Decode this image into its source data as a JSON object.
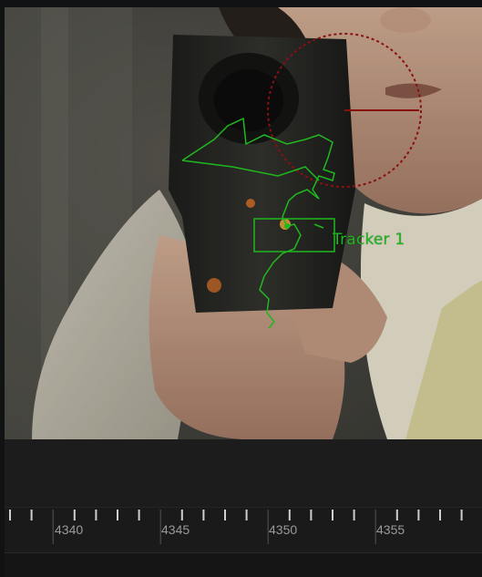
{
  "viewer": {
    "tracker": {
      "label": "Tracker 1",
      "color": "#1fb81f"
    },
    "offset_control": {
      "color": "#8a1010",
      "icon": "circle-crosshair-icon"
    }
  },
  "timeline": {
    "frame_labels": [
      "4340",
      "4345",
      "4350",
      "4355"
    ],
    "tick_color": "#cfcfcf",
    "label_color": "#9a9a9a"
  }
}
